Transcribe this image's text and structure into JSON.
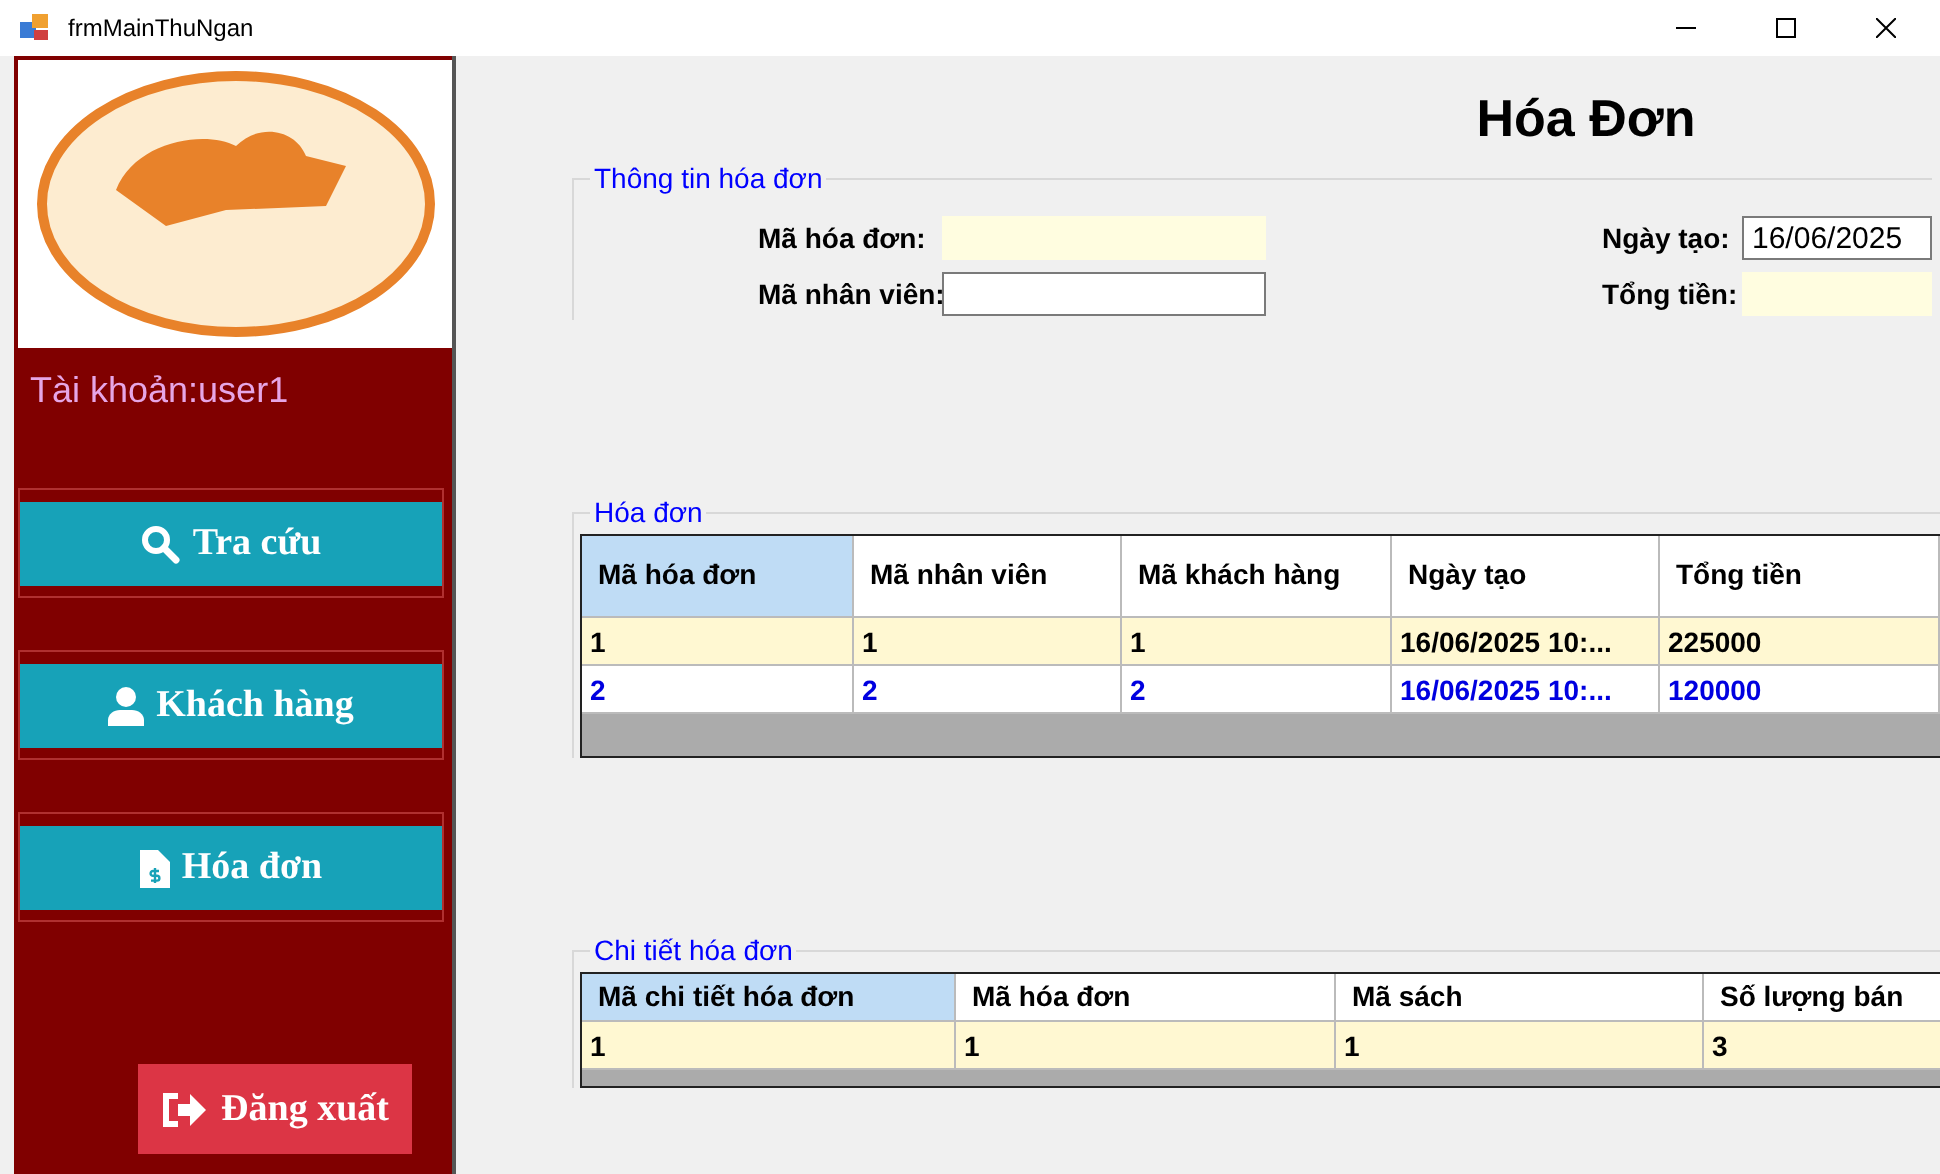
{
  "window": {
    "title": "frmMainThuNgan"
  },
  "sidebar": {
    "account": "Tài khoản:user1",
    "items": [
      {
        "kind": "search",
        "label": "Tra cứu"
      },
      {
        "kind": "customer",
        "label": "Khách hàng"
      },
      {
        "kind": "invoice",
        "label": "Hóa đơn"
      }
    ],
    "logout": "Đăng xuất"
  },
  "page_title": "Hóa Đơn",
  "info_group": {
    "title": "Thông tin hóa đơn",
    "fields": [
      {
        "label": "Mã hóa đơn:",
        "kind": "readonly"
      },
      {
        "label": "Ngày tạo:",
        "kind": "date",
        "value": "16/06/2025"
      },
      {
        "label": "Mã nhân viên:",
        "kind": "text"
      },
      {
        "label": "Tổng tiền:",
        "kind": "readonly"
      }
    ]
  },
  "invoices": {
    "title": "Hóa đơn",
    "columns": [
      {
        "label": "Mã hóa đơn",
        "selected": true
      },
      {
        "label": "Mã nhân viên",
        "selected": false
      },
      {
        "label": "Mã khách hàng",
        "selected": false
      },
      {
        "label": "Ngày tạo",
        "selected": false
      },
      {
        "label": "Tổng tiền",
        "selected": false
      }
    ],
    "rows": [
      {
        "kind": "plain",
        "cells": [
          "1",
          "1",
          "1",
          "16/06/2025 10:...",
          "225000"
        ]
      },
      {
        "kind": "alternate",
        "cells": [
          "2",
          "2",
          "2",
          "16/06/2025 10:...",
          "120000"
        ]
      }
    ]
  },
  "details": {
    "title": "Chi tiết hóa đơn",
    "columns": [
      {
        "label": "Mã chi tiết hóa đơn",
        "selected": true
      },
      {
        "label": "Mã hóa đơn",
        "selected": false
      },
      {
        "label": "Mã sách",
        "selected": false
      },
      {
        "label": "Số lượng bán",
        "selected": false
      }
    ],
    "rows": [
      {
        "kind": "plain",
        "cells": [
          "1",
          "1",
          "1",
          "3"
        ]
      }
    ]
  }
}
